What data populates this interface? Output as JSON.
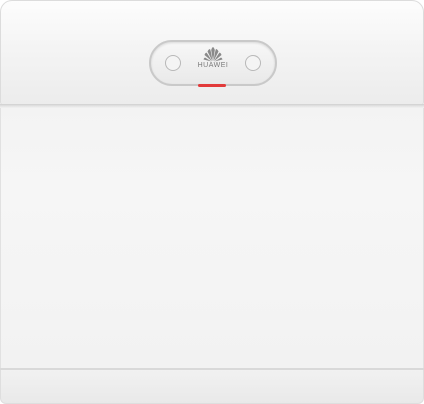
{
  "brand": {
    "name": "HUAWEI",
    "logo_icon": "huawei-petal-logo-icon"
  },
  "colors": {
    "enclosure": "#f3f3f3",
    "badge_border": "#c9c9c9",
    "status_led": "#e23a3a",
    "logo": "#8a8a8a"
  }
}
